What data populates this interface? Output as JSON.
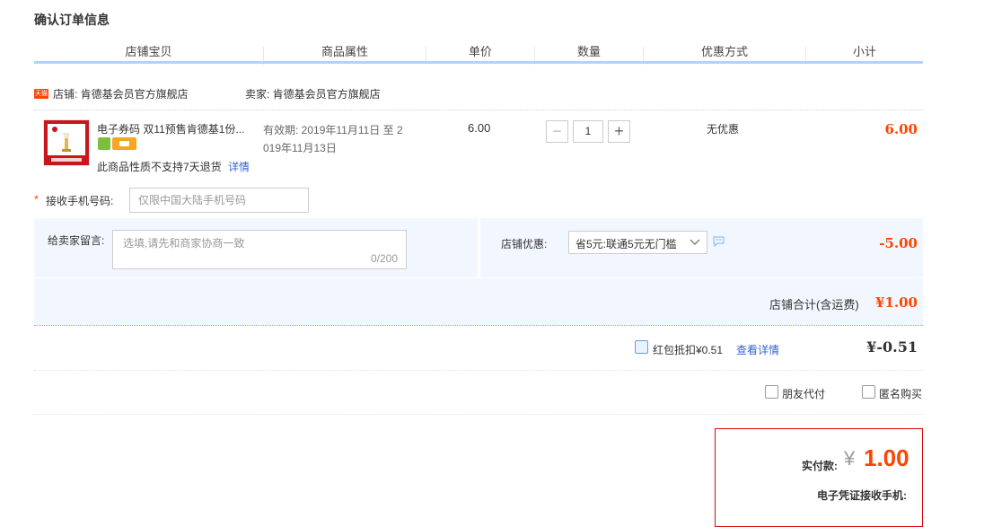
{
  "page_title": "确认订单信息",
  "columns": [
    "店铺宝贝",
    "商品属性",
    "单价",
    "数量",
    "优惠方式",
    "小计"
  ],
  "shop": {
    "badge": "天猫",
    "shop_label": "店铺: 肯德基会员官方旗舰店",
    "seller_label": "卖家: 肯德基会员官方旗舰店"
  },
  "item": {
    "name": "电子券码 双11预售肯德基1份...",
    "attr_line1": "有效期: 2019年11月11日 至 2",
    "attr_line2": "019年11月13日",
    "no_return": "此商品性质不支持7天退货",
    "detail_link": "详情",
    "price": "6.00",
    "quantity": "1",
    "minus": "−",
    "plus": "+",
    "discount": "无优惠",
    "subtotal": "6.00"
  },
  "phone": {
    "required_mark": "*",
    "label": "接收手机号码:",
    "placeholder": "仅限中国大陆手机号码"
  },
  "message": {
    "label": "给卖家留言:",
    "placeholder": "选填,请先和商家协商一致",
    "counter": "0/200"
  },
  "shop_coupon": {
    "label": "店铺优惠:",
    "selected": "省5元:联通5元无门槛",
    "amount": "-5.00"
  },
  "shop_total": {
    "label": "店铺合计(含运费)",
    "amount": "¥1.00"
  },
  "red_packet": {
    "label": "红包抵扣¥0.51",
    "link": "查看详情",
    "amount": "¥-0.51"
  },
  "options": {
    "friend_pay": "朋友代付",
    "anonymous": "匿名购买"
  },
  "payment": {
    "label": "实付款:",
    "currency": "¥",
    "amount": "1.00",
    "phone_label": "电子凭证接收手机:"
  },
  "colors": {
    "accent_orange": "#ff4400",
    "link_blue": "#3366cc",
    "header_line": "#b2d1ff",
    "panel_bg": "#f2f7ff",
    "pay_border": "#d70b0b"
  }
}
